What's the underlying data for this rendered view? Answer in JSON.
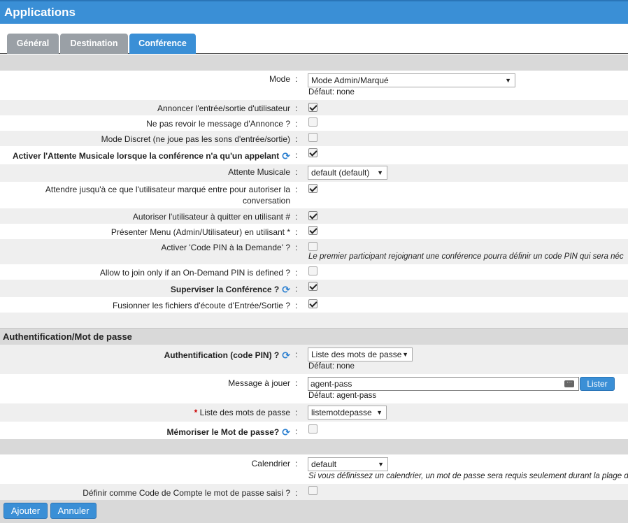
{
  "header": {
    "title": "Applications"
  },
  "tabs": [
    {
      "label": "Général"
    },
    {
      "label": "Destination"
    },
    {
      "label": "Conférence"
    }
  ],
  "conference": {
    "mode": {
      "label": "Mode",
      "value": "Mode Admin/Marqué",
      "default": "Défaut: none"
    },
    "announce_entry_exit": {
      "label": "Annoncer l'entrée/sortie d'utilisateur",
      "checked": true
    },
    "no_replay_announce": {
      "label": "Ne pas revoir le message d'Annonce ?",
      "checked": false
    },
    "quiet_mode": {
      "label": "Mode Discret (ne joue pas les sons d'entrée/sortie)",
      "checked": false
    },
    "moh_single_caller": {
      "label": "Activer l'Attente Musicale lorsque la conférence n'a qu'un appelant",
      "checked": true
    },
    "moh_class": {
      "label": "Attente Musicale",
      "value": "default (default)"
    },
    "wait_marked_user": {
      "label_line1": "Attendre jusqu'à ce que l'utilisateur marqué entre pour autoriser la",
      "label_line2": "conversation",
      "checked": true
    },
    "allow_exit_hash": {
      "label": "Autoriser l'utilisateur à quitter en utilisant #",
      "checked": true
    },
    "menu_star": {
      "label": "Présenter Menu (Admin/Utilisateur) en utilisant *",
      "checked": true
    },
    "on_demand_pin": {
      "label": "Activer 'Code PIN à la Demande' ?",
      "checked": false,
      "hint": "Le premier participant rejoignant une conférence pourra définir un code PIN qui sera néc"
    },
    "allow_join_pin": {
      "label": "Allow to join only if an On-Demand PIN is defined ?",
      "checked": false
    },
    "monitor": {
      "label": "Superviser la Conférence ?",
      "checked": true
    },
    "merge_recordings": {
      "label": "Fusionner les fichiers d'écoute d'Entrée/Sortie ?",
      "checked": true
    }
  },
  "auth": {
    "section_title": "Authentification/Mot de passe",
    "pin_auth": {
      "label": "Authentification (code PIN) ?",
      "value": "Liste des mots de passe",
      "default": "Défaut: none"
    },
    "prompt": {
      "label": "Message à jouer",
      "value": "agent-pass",
      "default": "Défaut: agent-pass",
      "list_button": "Lister"
    },
    "password_list": {
      "label": "Liste des mots de passe",
      "required_mark": "*",
      "value": "listemotdepasse"
    },
    "remember_password": {
      "label": "Mémoriser le Mot de passe?",
      "checked": false
    },
    "calendar": {
      "label": "Calendrier",
      "value": "default",
      "hint": "Si vous définissez un calendrier, un mot de passe sera requis seulement durant la plage d"
    },
    "account_code": {
      "label": "Définir comme Code de Compte le mot de passe saisi ?",
      "checked": false
    }
  },
  "colon": ":",
  "footer": {
    "add_label": "Ajouter",
    "cancel_label": "Annuler"
  },
  "colors": {
    "accent": "#3a8fd6",
    "band": "#d9d9d9",
    "row_alt": "#efefef",
    "required": "#cc0000"
  },
  "icons": {
    "refresh": "refresh-icon",
    "more": "more-options-icon",
    "dropdown": "chevron-down-icon"
  }
}
